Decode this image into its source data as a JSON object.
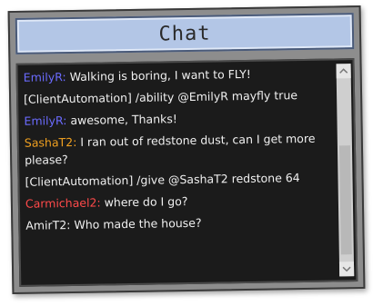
{
  "window": {
    "title": "Chat"
  },
  "colors": {
    "title_bg": "#b3c6e6",
    "chat_bg": "#1b1b1b",
    "text": "#f0f0f0"
  },
  "chat": {
    "messages": [
      {
        "sender": "EmilyR:",
        "sender_color": "#6b6bff",
        "text": " Walking is boring, I want to FLY!"
      },
      {
        "sender": "",
        "sender_color": "#f0f0f0",
        "text": "[ClientAutomation] /ability @EmilyR mayfly true"
      },
      {
        "sender": "EmilyR:",
        "sender_color": "#6b6bff",
        "text": " awesome, Thanks!"
      },
      {
        "sender": "SashaT2:",
        "sender_color": "#f0a020",
        "text": " I ran out of redstone dust, can I get more please?"
      },
      {
        "sender": "",
        "sender_color": "#f0f0f0",
        "text": "[ClientAutomation] /give @SashaT2 redstone 64"
      },
      {
        "sender": "Carmichael2:",
        "sender_color": "#ff4a4a",
        "text": " where do I go?"
      },
      {
        "sender": "",
        "sender_color": "#f0f0f0",
        "text": "AmirT2: Who made the house?"
      }
    ]
  },
  "scrollbar": {
    "up_icon": "chevron-up-icon",
    "down_icon": "chevron-down-icon"
  }
}
